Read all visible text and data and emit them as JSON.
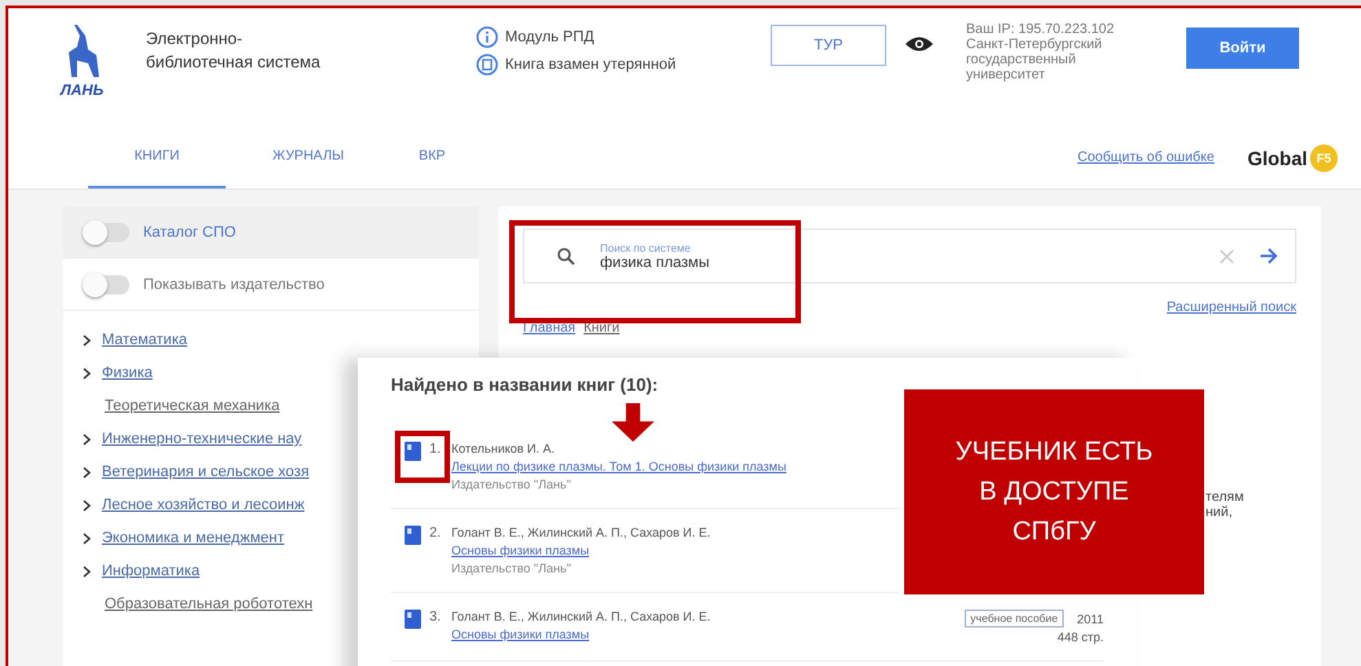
{
  "header": {
    "logo": "ЛАНЬ",
    "site_name": [
      "Электронно-",
      "библиотечная система"
    ],
    "links": [
      {
        "kind": "info",
        "label": "Модуль РПД"
      },
      {
        "kind": "book",
        "label": "Книга взамен утерянной"
      }
    ],
    "tour_button": "ТУР",
    "ip_info": [
      "Ваш IP: 195.70.223.102",
      "Санкт-Петербургский",
      "государственный",
      "университет"
    ],
    "login_button": "Войти"
  },
  "tabs": [
    {
      "label": "КНИГИ",
      "selected": true
    },
    {
      "label": "ЖУРНАЛЫ",
      "selected": false
    },
    {
      "label": "ВКР",
      "selected": false
    }
  ],
  "report_link": "Сообщить об ошибке",
  "partner_logo": {
    "text": "Global",
    "badge": "F5"
  },
  "sidebar": {
    "toggles": [
      {
        "label": "Каталог СПО",
        "on": false,
        "highlighted": true
      },
      {
        "label": "Показывать издательство",
        "on": false,
        "highlighted": false
      }
    ],
    "items": [
      {
        "label": "Математика",
        "kind": "group"
      },
      {
        "label": "Физика",
        "kind": "group"
      },
      {
        "label": "Теоретическая механика",
        "kind": "leaf"
      },
      {
        "label": "Инженерно-технические нау",
        "kind": "group"
      },
      {
        "label": "Ветеринария и сельское хозя",
        "kind": "group"
      },
      {
        "label": "Лесное хозяйство и лесоинж",
        "kind": "group"
      },
      {
        "label": "Экономика и менеджмент",
        "kind": "group"
      },
      {
        "label": "Информатика",
        "kind": "group"
      },
      {
        "label": "Образовательная робототехн",
        "kind": "leaf"
      }
    ]
  },
  "search": {
    "label": "Поиск по системе",
    "value": "физика плазмы",
    "advanced_link": "Расширенный поиск"
  },
  "breadcrumbs": [
    "Главная",
    "Книги"
  ],
  "description_fragments": [
    "телям",
    "ний,"
  ],
  "results": {
    "heading": "Найдено в названии книг (10):",
    "items": [
      {
        "number": "1.",
        "author": "Котельников И. А.",
        "title": "Лекции по физике плазмы. Том 1. Основы физики плазмы",
        "publisher": "Издательство \"Лань\"",
        "highlighted": true
      },
      {
        "number": "2.",
        "author": "Голант В. Е., Жилинский А. П., Сахаров И. Е.",
        "title": "Основы физики плазмы",
        "publisher": "Издательство \"Лань\"",
        "highlighted": false
      },
      {
        "number": "3.",
        "author": "Голант В. Е., Жилинский А. П., Сахаров И. Е.",
        "title": "Основы физики плазмы",
        "tag": "учебное пособие",
        "year": "2011",
        "pages": "448 стр.",
        "highlighted": false
      }
    ]
  },
  "callout": [
    "УЧЕБНИК ЕСТЬ",
    "В ДОСТУПЕ",
    "СПбГУ"
  ]
}
